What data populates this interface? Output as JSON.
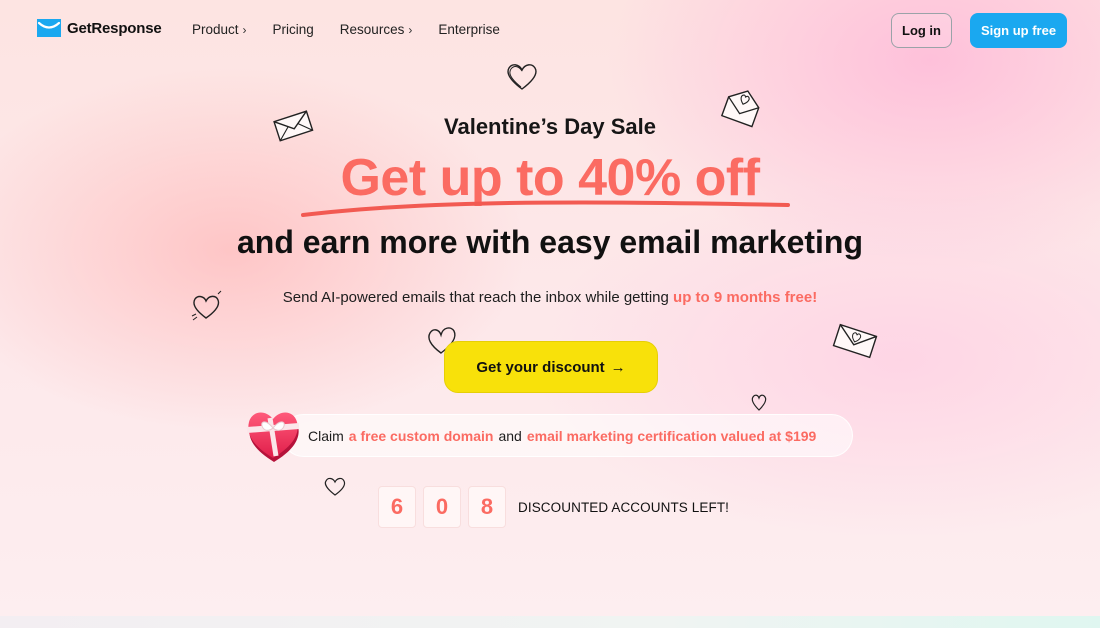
{
  "brand": {
    "name": "GetResponse",
    "color": "#1aa8f0"
  },
  "nav": {
    "items": [
      {
        "label": "Product",
        "chevron": "›"
      },
      {
        "label": "Pricing",
        "chevron": ""
      },
      {
        "label": "Resources",
        "chevron": "›"
      },
      {
        "label": "Enterprise",
        "chevron": ""
      }
    ],
    "login_label": "Log in",
    "signup_label": "Sign up free"
  },
  "hero": {
    "eyebrow": "Valentine’s Day Sale",
    "headline": "Get up to 40% off",
    "subhead": "and earn more with easy email marketing",
    "description_prefix": "Send AI-powered emails that reach the inbox while getting ",
    "description_highlight": "up to 9 months free!",
    "cta_label": "Get your discount",
    "cta_arrow": "→"
  },
  "claim": {
    "prefix": "Claim",
    "highlight1": "a free custom domain",
    "middle": "and",
    "highlight2": "email marketing certification valued at $199"
  },
  "counter": {
    "digits": [
      "6",
      "0",
      "8"
    ],
    "label": "DISCOUNTED ACCOUNTS LEFT!"
  },
  "colors": {
    "accent": "#fb6b62",
    "cta": "#f8e10a",
    "signup": "#1aa8f0"
  },
  "icons": {
    "logo": "envelope-logo-icon",
    "doodles": [
      "heart-doodle-icon",
      "envelope-doodle-icon",
      "open-envelope-heart-doodle-icon",
      "heart-gift-box-icon"
    ]
  }
}
